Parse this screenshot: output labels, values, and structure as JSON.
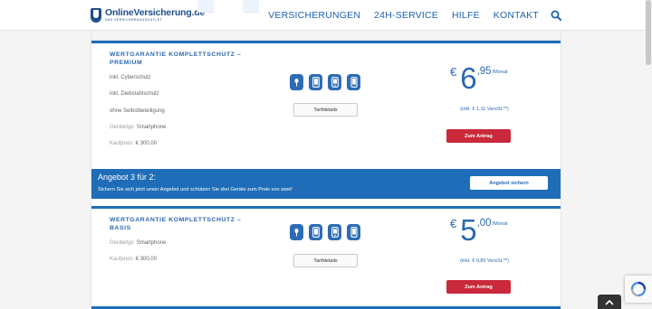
{
  "header": {
    "logo_main": "OnlineVersicherung.de",
    "logo_sub": "DAS VERSICHERUNGSOUTLET",
    "nav": [
      "VERSICHERUNGEN",
      "24H-SERVICE",
      "HILFE",
      "KONTAKT"
    ],
    "search_icon": "search-icon"
  },
  "offers": [
    {
      "title_line1": "WERTGARANTIE KOMPLETTSCHUTZ –",
      "title_line2": "PREMIUM",
      "features": [
        "inkl. Cyberschutz",
        "inkl. Diebstahlschutz",
        "ohne Selbstbeteiligung"
      ],
      "device_type_label": "Gerätetyp:",
      "device_type_value": "Smartphone",
      "purchase_price_label": "Kaufpreis:",
      "purchase_price_value": "€ 300,00",
      "devices": [
        "smartphone-icon",
        "tablet-icon",
        "phone-icon",
        "mobile-icon"
      ],
      "tariff_button": "Tarifdetails",
      "currency": "€",
      "price_main": "6",
      "price_cents": ",95",
      "price_unit": "/Monat",
      "vat_note": "(inkl. € 1,11 VersSt.**)",
      "order_button": "Zum Antrag"
    },
    {
      "title_line1": "WERTGARANTIE KOMPLETTSCHUTZ –",
      "title_line2": "BASIS",
      "features": [],
      "device_type_label": "Gerätetyp:",
      "device_type_value": "Smartphone",
      "purchase_price_label": "Kaufpreis:",
      "purchase_price_value": "€ 300,00",
      "devices": [
        "smartphone-icon",
        "tablet-icon",
        "phone-icon",
        "mobile-icon"
      ],
      "tariff_button": "Tarifdetails",
      "currency": "€",
      "price_main": "5",
      "price_cents": ",00",
      "price_unit": "/Monat",
      "vat_note": "(inkl. € 0,80 VersSt.**)",
      "order_button": "Zum Antrag"
    }
  ],
  "banner": {
    "title": "Angebot 3 für 2:",
    "text": "Sichern Sie sich jetzt unser Angebot und schützen Sie drei Geräte zum Preis von zwei!",
    "button": "Angebot sichern"
  },
  "colors": {
    "brand_blue": "#1f6db8",
    "link_blue": "#2a67b1",
    "order_red": "#c9293a"
  }
}
